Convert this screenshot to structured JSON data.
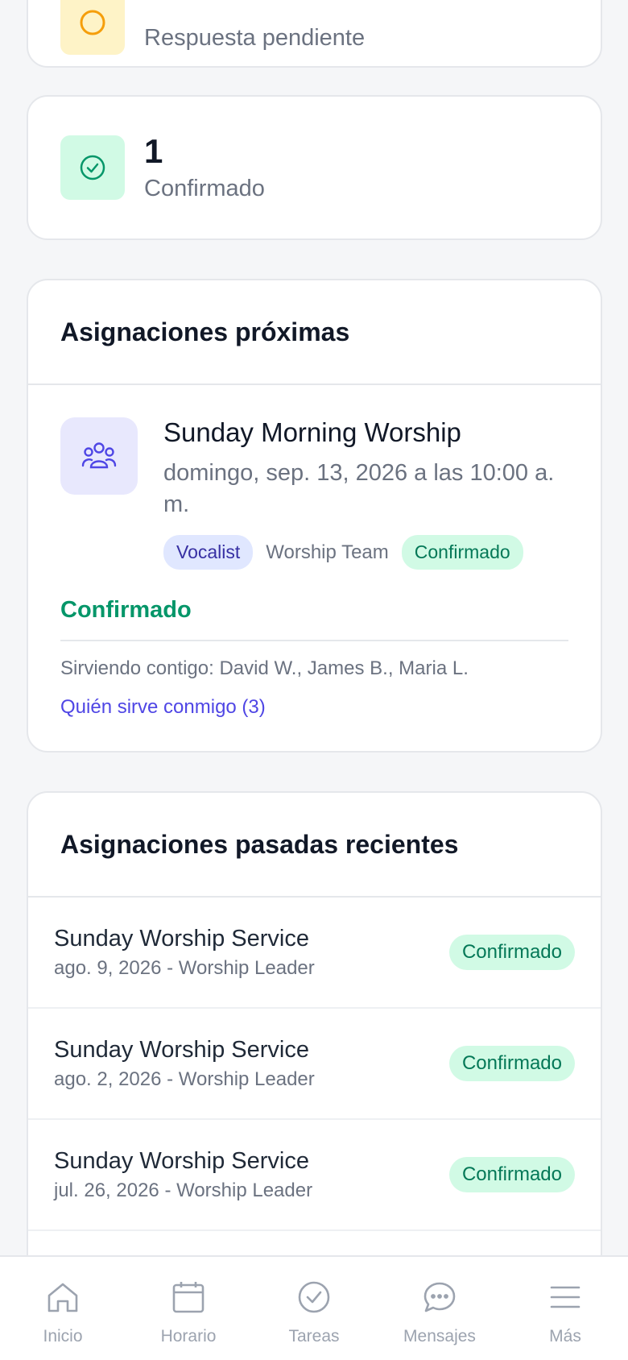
{
  "pending_card": {
    "label": "Respuesta pendiente"
  },
  "confirmed_card": {
    "count": "1",
    "label": "Confirmado"
  },
  "upcoming": {
    "heading": "Asignaciones próximas",
    "assignment": {
      "title": "Sunday Morning Worship",
      "date": "domingo, sep. 13, 2026 a las 10:00 a. m.",
      "role": "Vocalist",
      "team": "Worship Team",
      "status_tag": "Confirmado",
      "status_text": "Confirmado",
      "serving_with": "Sirviendo contigo: David W., James B., Maria L.",
      "who_link": "Quién sirve conmigo (3)"
    }
  },
  "past": {
    "heading": "Asignaciones pasadas recientes",
    "items": [
      {
        "title": "Sunday Worship Service",
        "sub": "ago. 9, 2026 - Worship Leader",
        "status": "Confirmado"
      },
      {
        "title": "Sunday Worship Service",
        "sub": "ago. 2, 2026 - Worship Leader",
        "status": "Confirmado"
      },
      {
        "title": "Sunday Worship Service",
        "sub": "jul. 26, 2026 - Worship Leader",
        "status": "Confirmado"
      }
    ]
  },
  "nav": [
    {
      "label": "Inicio",
      "icon": "home-icon"
    },
    {
      "label": "Horario",
      "icon": "calendar-icon"
    },
    {
      "label": "Tareas",
      "icon": "check-circle-icon"
    },
    {
      "label": "Mensajes",
      "icon": "chat-icon"
    },
    {
      "label": "Más",
      "icon": "menu-icon"
    }
  ],
  "colors": {
    "accent": "#4f46e5",
    "success": "#059669",
    "muted": "#9ca3af"
  }
}
